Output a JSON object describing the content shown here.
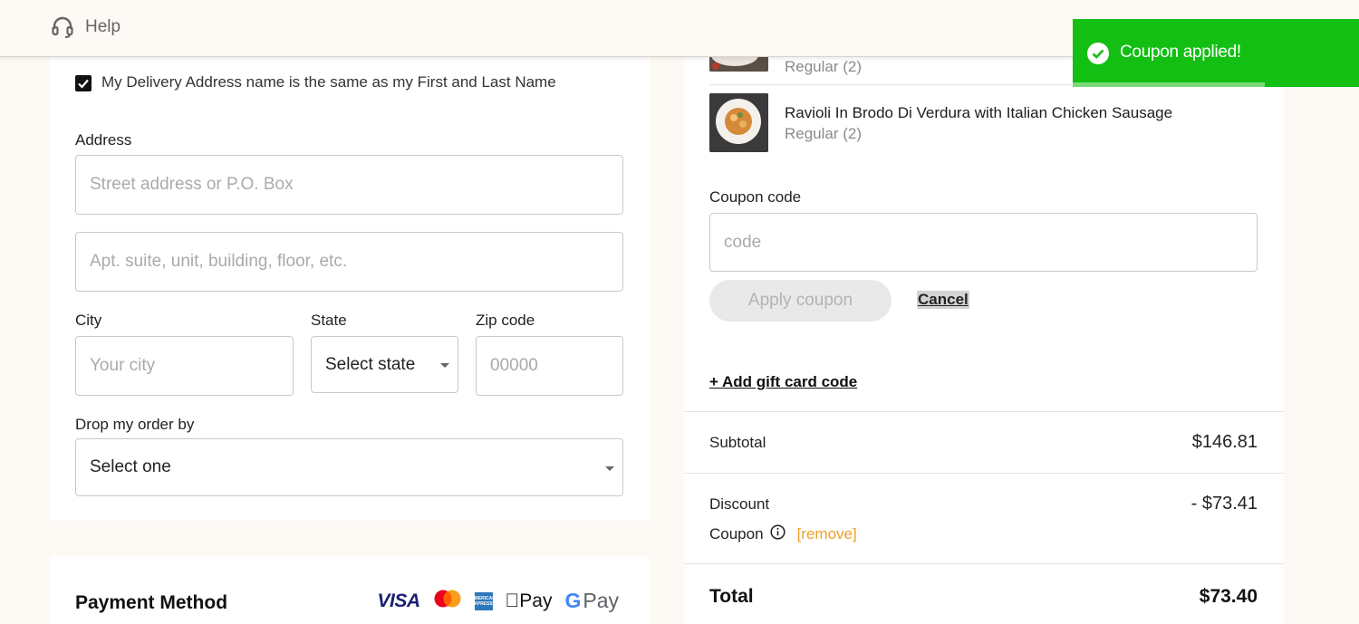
{
  "header": {
    "help_label": "Help"
  },
  "delivery": {
    "same_name_checked": true,
    "same_name_label": "My Delivery Address name is the same as my First and Last Name",
    "address_label": "Address",
    "street_placeholder": "Street address or P.O. Box",
    "apt_placeholder": "Apt. suite, unit, building, floor, etc.",
    "city_label": "City",
    "city_placeholder": "Your city",
    "state_label": "State",
    "state_value": "Select state",
    "zip_label": "Zip code",
    "zip_placeholder": "00000",
    "drop_label": "Drop my order by",
    "drop_value": "Select one"
  },
  "payment": {
    "title": "Payment Method",
    "icons": {
      "visa": "VISA",
      "amex": "AMERICAN EXPRESS",
      "applepay": "Pay",
      "gpay_g": "G",
      "gpay": "Pay"
    }
  },
  "cart": {
    "items": [
      {
        "name": "",
        "variant": "Regular (2)"
      },
      {
        "name": "Ravioli In Brodo Di Verdura with Italian Chicken Sausage",
        "variant": "Regular (2)"
      }
    ]
  },
  "coupon": {
    "label": "Coupon code",
    "placeholder": "code",
    "apply_label": "Apply coupon",
    "cancel_label": "Cancel",
    "gift_label": "+ Add gift card code"
  },
  "summary": {
    "subtotal_label": "Subtotal",
    "subtotal_value": "$146.81",
    "discount_label": "Discount",
    "discount_value": "- $73.41",
    "coupon_label": "Coupon",
    "remove_label": "[remove]",
    "total_label": "Total",
    "total_value": "$73.40"
  },
  "toast": {
    "message": "Coupon applied!",
    "color": "#13bf13",
    "progress": 0.67
  },
  "colors": {
    "accent_orange": "#f0a028",
    "toast_green": "#13bf13"
  }
}
